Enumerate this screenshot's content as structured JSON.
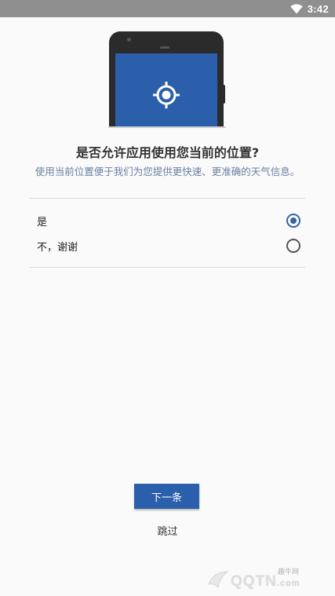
{
  "status_bar": {
    "time": "3:42",
    "icons": [
      "wifi-icon"
    ]
  },
  "illustration": {
    "icon": "location-target-icon",
    "screen_color": "#2c5fab"
  },
  "dialog": {
    "title": "是否允许应用使用您当前的位置?",
    "subtitle": "使用当前位置便于我们为您提供更快速、更准确的天气信息。"
  },
  "options": [
    {
      "label": "是",
      "selected": true
    },
    {
      "label": "不，谢谢",
      "selected": false
    }
  ],
  "actions": {
    "next_label": "下一条",
    "skip_label": "跳过"
  },
  "watermark": {
    "small": "趣牛网",
    "big": "QQTN",
    "suffix": ".com"
  },
  "colors": {
    "accent": "#2c5fab",
    "status_bar": "#8f8f8f",
    "subtitle": "#6b7fa1"
  }
}
